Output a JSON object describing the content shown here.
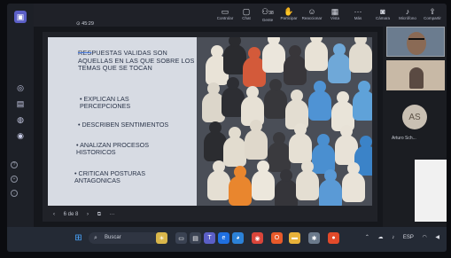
{
  "toolbar": {
    "timer": "45:29",
    "buttons": [
      {
        "label": "Controlar",
        "icon": "control-icon"
      },
      {
        "label": "Chat",
        "icon": "chat-icon"
      },
      {
        "label": "Gente",
        "icon": "people-icon",
        "badge": "38"
      },
      {
        "label": "Participar",
        "icon": "raise-hand-icon"
      },
      {
        "label": "Reaccionar",
        "icon": "react-icon"
      },
      {
        "label": "Vista",
        "icon": "view-icon"
      },
      {
        "label": "Más",
        "icon": "more-icon"
      },
      {
        "label": "Cámara",
        "icon": "camera-icon"
      },
      {
        "label": "Micrófono",
        "icon": "mic-icon"
      },
      {
        "label": "Compartir",
        "icon": "share-icon"
      }
    ]
  },
  "slide": {
    "title_struck": "RES",
    "title_rest": "PUESTAS VALIDAS SON AQUELLAS EN LAS QUE SOBRE LOS TEMAS QUE SE TOCAN",
    "bullets": [
      "• EXPLICAN LAS PERCEPCIONES",
      "• DESCRIBEN SENTIMIENTOS",
      "• ANALIZAN PROCESOS HISTORICOS",
      "• CRITICAN POSTURAS ANTAGONICAS"
    ],
    "counter": "6 de 8"
  },
  "participants": {
    "avatar_initials": "AS",
    "name": "Arturo Sch..."
  },
  "taskbar": {
    "search_label": "Buscar",
    "language": "ESP"
  }
}
